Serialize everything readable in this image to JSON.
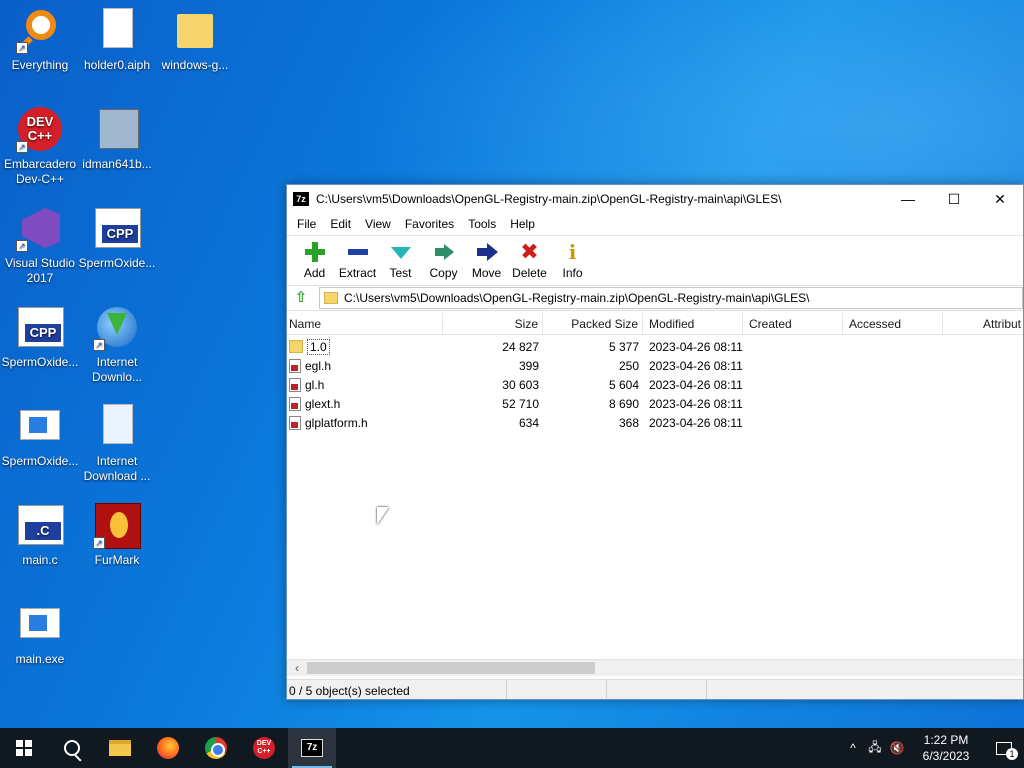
{
  "desktop": {
    "icons": [
      {
        "label": "Everything",
        "icon": "everything-search-icon"
      },
      {
        "label": "holder0.aiph",
        "icon": "file-icon"
      },
      {
        "label": "windows-g...",
        "icon": "folder-icon"
      },
      {
        "label": "Embarcadero Dev-C++",
        "icon": "dev-cpp-icon"
      },
      {
        "label": "idman641b...",
        "icon": "installer-icon"
      },
      {
        "label": "Visual Studio 2017",
        "icon": "visual-studio-icon"
      },
      {
        "label": "SpermOxide...",
        "icon": "cpp-file-icon"
      },
      {
        "label": "SpermOxide...",
        "icon": "cpp-file-icon"
      },
      {
        "label": "Internet Downlo...",
        "icon": "idm-icon"
      },
      {
        "label": "SpermOxide...",
        "icon": "exe-icon"
      },
      {
        "label": "Internet Download ...",
        "icon": "image-file-icon"
      },
      {
        "label": "main.c",
        "icon": "c-file-icon"
      },
      {
        "label": "FurMark",
        "icon": "furmark-icon"
      },
      {
        "label": "main.exe",
        "icon": "exe-icon"
      }
    ]
  },
  "window": {
    "app_icon_text": "7z",
    "title": "C:\\Users\\vm5\\Downloads\\OpenGL-Registry-main.zip\\OpenGL-Registry-main\\api\\GLES\\",
    "controls": {
      "minimize": "—",
      "maximize": "☐",
      "close": "✕"
    },
    "menu": [
      "File",
      "Edit",
      "View",
      "Favorites",
      "Tools",
      "Help"
    ],
    "toolbar": [
      {
        "label": "Add",
        "icon": "add-icon"
      },
      {
        "label": "Extract",
        "icon": "extract-icon"
      },
      {
        "label": "Test",
        "icon": "test-icon"
      },
      {
        "label": "Copy",
        "icon": "copy-icon"
      },
      {
        "label": "Move",
        "icon": "move-icon"
      },
      {
        "label": "Delete",
        "icon": "delete-icon"
      },
      {
        "label": "Info",
        "icon": "info-icon"
      }
    ],
    "address": "C:\\Users\\vm5\\Downloads\\OpenGL-Registry-main.zip\\OpenGL-Registry-main\\api\\GLES\\",
    "columns": [
      "Name",
      "Size",
      "Packed Size",
      "Modified",
      "Created",
      "Accessed",
      "Attribut"
    ],
    "files": [
      {
        "name": "1.0",
        "type": "folder",
        "size": "24 827",
        "packed": "5 377",
        "modified": "2023-04-26 08:11",
        "created": "",
        "accessed": "",
        "attr": ""
      },
      {
        "name": "egl.h",
        "type": "file",
        "size": "399",
        "packed": "250",
        "modified": "2023-04-26 08:11",
        "created": "",
        "accessed": "",
        "attr": ""
      },
      {
        "name": "gl.h",
        "type": "file",
        "size": "30 603",
        "packed": "5 604",
        "modified": "2023-04-26 08:11",
        "created": "",
        "accessed": "",
        "attr": ""
      },
      {
        "name": "glext.h",
        "type": "file",
        "size": "52 710",
        "packed": "8 690",
        "modified": "2023-04-26 08:11",
        "created": "",
        "accessed": "",
        "attr": ""
      },
      {
        "name": "glplatform.h",
        "type": "file",
        "size": "634",
        "packed": "368",
        "modified": "2023-04-26 08:11",
        "created": "",
        "accessed": "",
        "attr": ""
      }
    ],
    "status": {
      "selection": "0 / 5 object(s) selected",
      "size": "",
      "packed": "",
      "date": ""
    }
  },
  "taskbar": {
    "apps": [
      {
        "name": "start",
        "icon": "windows-start-icon",
        "active": false
      },
      {
        "name": "search",
        "icon": "search-icon",
        "active": false
      },
      {
        "name": "file-explorer",
        "icon": "file-explorer-icon",
        "active": false
      },
      {
        "name": "firefox",
        "icon": "firefox-icon",
        "active": false
      },
      {
        "name": "chrome",
        "icon": "chrome-icon",
        "active": false
      },
      {
        "name": "dev-cpp",
        "icon": "dev-cpp-icon",
        "active": false
      },
      {
        "name": "7-zip",
        "icon": "7zip-icon",
        "active": true
      }
    ],
    "tray": {
      "chevron": "^",
      "time": "1:22 PM",
      "date": "6/3/2023",
      "notifications": "1"
    }
  }
}
